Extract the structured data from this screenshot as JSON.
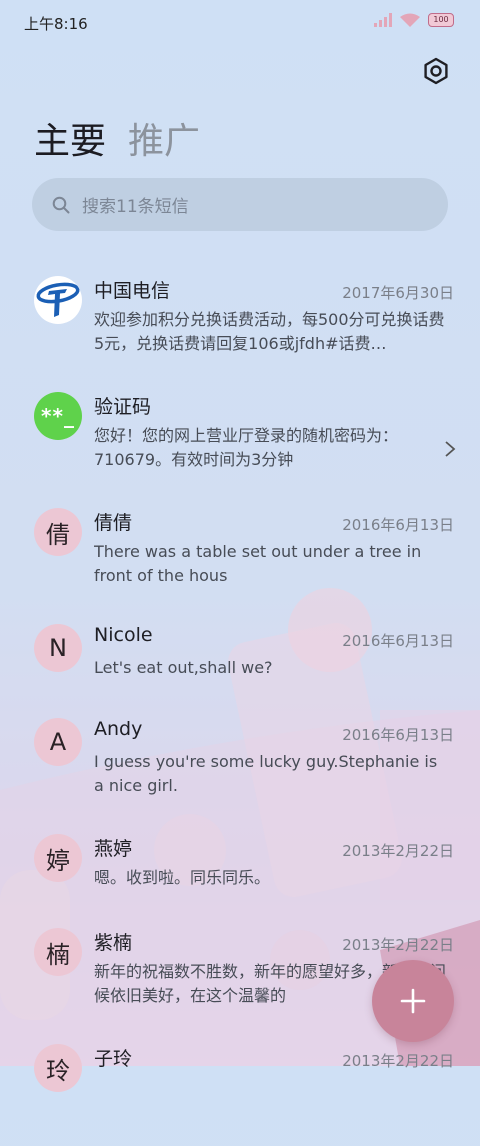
{
  "status_bar": {
    "time": "上午8:16",
    "battery": "100"
  },
  "tabs": {
    "main": "主要",
    "promo": "推广"
  },
  "search": {
    "placeholder": "搜索11条短信"
  },
  "messages": [
    {
      "name": "中国电信",
      "date": "2017年6月30日",
      "preview": "欢迎参加积分兑换话费活动，每500分可兑换话费5元，兑换话费请回复106或jfdh#话费…",
      "avatar": "china-telecom-logo"
    },
    {
      "name": "验证码",
      "date": "",
      "preview": "您好！您的网上营业厅登录的随机密码为：710679。有效时间为3分钟",
      "avatar_text": "**_"
    },
    {
      "name": "倩倩",
      "date": "2016年6月13日",
      "preview": "There was a table set out under a tree in front of the hous",
      "avatar_text": "倩"
    },
    {
      "name": "Nicole",
      "date": "2016年6月13日",
      "preview": "Let's eat out,shall we?",
      "avatar_text": "N"
    },
    {
      "name": "Andy",
      "date": "2016年6月13日",
      "preview": "I guess you're some lucky guy.Stephanie is a nice girl.",
      "avatar_text": "A"
    },
    {
      "name": "燕婷",
      "date": "2013年2月22日",
      "preview": "嗯。收到啦。同乐同乐。",
      "avatar_text": "婷"
    },
    {
      "name": "紫楠",
      "date": "2013年2月22日",
      "preview": "新年的祝福数不胜数，新年的愿望好多，新年的问候依旧美好，在这个温馨的",
      "avatar_text": "楠"
    },
    {
      "name": "子玲",
      "date": "2013年2月22日",
      "preview": "",
      "avatar_text": "玲"
    }
  ],
  "colors": {
    "accent": "#c8849a",
    "avatar_pink": "#ecc7d4",
    "avatar_green": "#5fd24b"
  }
}
